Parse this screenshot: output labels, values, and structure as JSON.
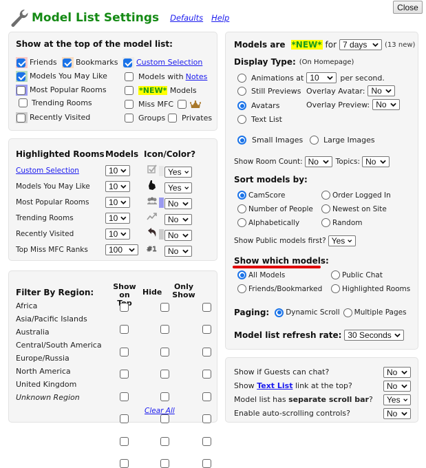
{
  "header": {
    "title": "Model List Settings",
    "defaults_link": "Defaults",
    "help_link": "Help",
    "close_label": "Close",
    "icon": "wrench-icon"
  },
  "show_top": {
    "heading": "Show at the top of the model list:",
    "items": [
      {
        "label": "Friends",
        "checked": true,
        "color": "#f8c8c8"
      },
      {
        "label": "Bookmarks",
        "checked": true,
        "color": "#f8dcc0"
      },
      {
        "label": "Custom Selection",
        "checked": true,
        "link": true,
        "color": "#e6e6e6"
      },
      {
        "label": "Models You May Like",
        "checked": true,
        "color": "#b8dcc0"
      },
      {
        "label_prefix": "Models with ",
        "label_link": "Notes",
        "checked": false
      },
      {
        "label": "Most Popular Rooms",
        "checked": false,
        "color": "#9a9af0"
      },
      {
        "label_new": "*NEW*",
        "label": " Models",
        "checked": false
      },
      {
        "label": "Trending Rooms",
        "checked": false
      },
      {
        "label": "Miss MFC",
        "checked": false,
        "extra_checked": false,
        "extra_icon": "crown-icon"
      },
      {
        "label": "Recently Visited",
        "checked": false,
        "color": "#cccccc"
      },
      {
        "label": "Groups",
        "checked": false
      },
      {
        "label": "Privates",
        "checked": false
      }
    ]
  },
  "highlighted": {
    "heading": "Highlighted Rooms",
    "col_models": "Models",
    "col_icon": "Icon/Color?",
    "rows": [
      {
        "label": "Custom Selection",
        "link": true,
        "models": "10",
        "icon": "checkbox-icon",
        "color": "#e8e8e8",
        "value": "Yes"
      },
      {
        "label": "Models You May Like",
        "models": "10",
        "icon": "thumbs-up-icon",
        "color": "",
        "value": "Yes"
      },
      {
        "label": "Most Popular Rooms",
        "models": "10",
        "icon": "crowd-icon",
        "color": "#9a9af0",
        "value": "No"
      },
      {
        "label": "Trending Rooms",
        "models": "10",
        "icon": "trending-icon",
        "color": "",
        "value": "No"
      },
      {
        "label": "Recently Visited",
        "models": "10",
        "icon": "undo-arrow-icon",
        "color": "#cccccc",
        "value": "No"
      },
      {
        "label": "Top Miss MFC Ranks",
        "models": "100",
        "icon": "rank-one-icon",
        "color": "",
        "value": "No"
      }
    ]
  },
  "region": {
    "heading": "Filter By Region:",
    "col_top_1": "Show",
    "col_top_2": "on Top",
    "col_hide": "Hide",
    "col_only_1": "Only",
    "col_only_2": "Show",
    "rows": [
      {
        "label": "Africa"
      },
      {
        "label": "Asia/Pacific Islands"
      },
      {
        "label": "Australia"
      },
      {
        "label": "Central/South America"
      },
      {
        "label": "Europe/Russia"
      },
      {
        "label": "North America"
      },
      {
        "label": "United Kingdom"
      },
      {
        "label": "Unknown Region",
        "italic": true
      }
    ],
    "clear_all": "Clear All"
  },
  "right": {
    "models_are": "Models are",
    "new_tag": "*NEW*",
    "for": "for",
    "new_days": "7 days",
    "new_count": "(13 new)",
    "display_type": "Display Type:",
    "display_note": "(On Homepage)",
    "animations_label": "Animations at",
    "animations_rate": "10",
    "per_second": "per second.",
    "still_previews": "Still Previews",
    "overlay_avatar_label": "Overlay Avatar:",
    "overlay_avatar": "No",
    "avatars": "Avatars",
    "overlay_preview_label": "Overlay Preview:",
    "overlay_preview": "No",
    "text_list": "Text List",
    "display_selected": "Avatars",
    "small_images": "Small Images",
    "large_images": "Large Images",
    "size_selected": "Small Images",
    "room_count_label": "Show Room Count:",
    "room_count": "No",
    "topics_label": "Topics:",
    "topics": "No",
    "sort_heading": "Sort models by:",
    "sort_options": [
      "CamScore",
      "Order Logged In",
      "Number of People",
      "Newest on Site",
      "Alphabetically",
      "Random"
    ],
    "sort_selected": "CamScore",
    "public_first_label": "Show Public models first?",
    "public_first": "Yes",
    "which_heading": "Show which models:",
    "which_options": [
      "All Models",
      "Public Chat",
      "Friends/Bookmarked",
      "Highlighted Rooms"
    ],
    "which_selected": "All Models",
    "paging_label": "Paging:",
    "paging_options": [
      "Dynamic Scroll",
      "Multiple Pages"
    ],
    "paging_selected": "Dynamic Scroll",
    "refresh_label": "Model list refresh rate:",
    "refresh": "30 Seconds"
  },
  "misc": {
    "guests_label": "Show if Guests can chat?",
    "guests": "No",
    "textlist_pre": "Show ",
    "textlist_link": "Text List",
    "textlist_post": " link at the top?",
    "textlist": "No",
    "scroll_pre": "Model list has ",
    "scroll_bold": "separate scroll bar",
    "scroll_post": "?",
    "scroll": "Yes",
    "autoscroll_label": "Enable auto-scrolling controls?",
    "autoscroll": "No"
  }
}
